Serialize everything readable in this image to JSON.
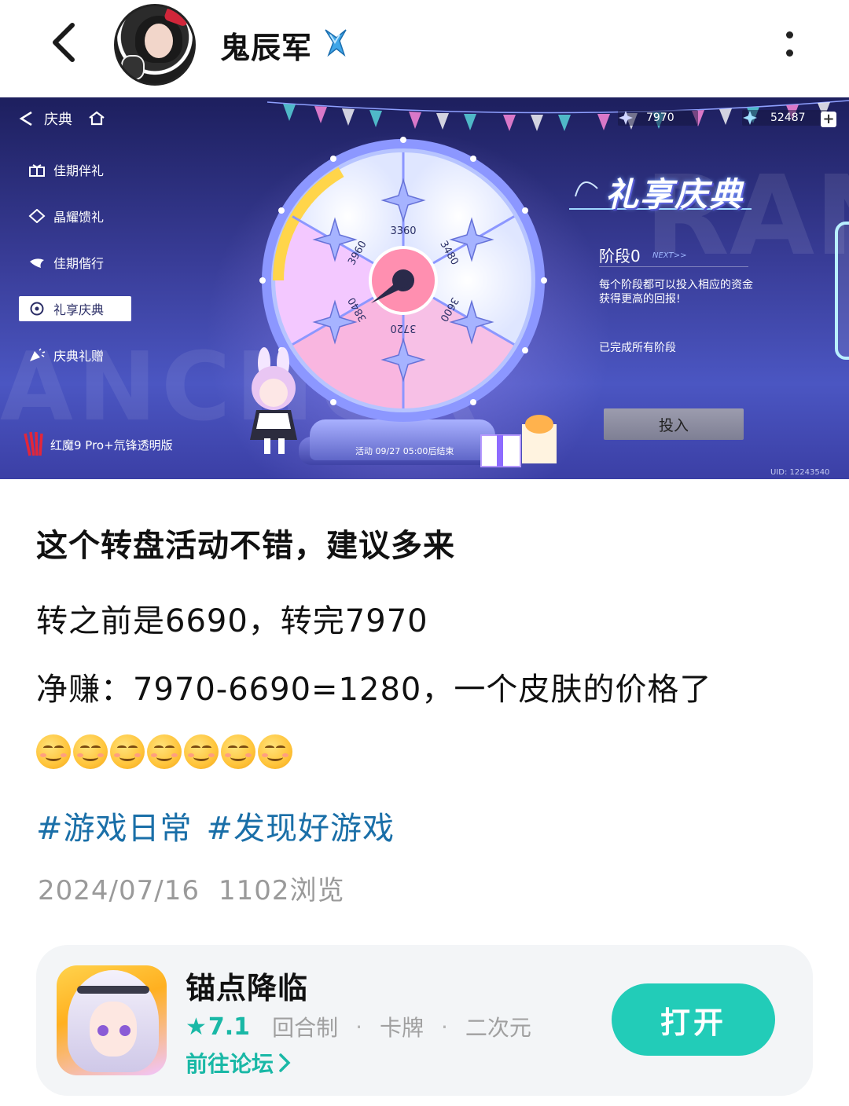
{
  "header": {
    "username": "鬼辰军"
  },
  "banner": {
    "nav_title": "庆典",
    "menu": [
      {
        "label": "佳期伴礼"
      },
      {
        "label": "晶耀馈礼"
      },
      {
        "label": "佳期偕行"
      },
      {
        "label": "礼享庆典"
      },
      {
        "label": "庆典礼赠"
      }
    ],
    "brand_label": "红魔9 Pro+氘锋透明版",
    "currency_1": "7970",
    "currency_2": "52487",
    "plus_label": "+",
    "event_title": "礼享庆典",
    "stage_label": "阶段0",
    "next_label": "NEXT>>",
    "stage_desc": "每个阶段都可以投入相应的资金获得更高的回报!",
    "stage_done": "已完成所有阶段",
    "invest_label": "投入",
    "event_time": "活动 09/27 05:00后结束",
    "uid": "UID: 12243540",
    "wheel_values": [
      "3360",
      "3480",
      "3600",
      "3720",
      "3840",
      "3960"
    ]
  },
  "post": {
    "title": "这个转盘活动不错，建议多来",
    "line1": "转之前是6690，转完7970",
    "line2": "净赚：7970-6690=1280，一个皮肤的价格了",
    "emoji_count": 7,
    "tags": [
      "#游戏日常",
      "#发现好游戏"
    ],
    "date": "2024/07/16",
    "views": "1102浏览"
  },
  "game_card": {
    "name": "锚点降临",
    "rating": "7.1",
    "genres": [
      "回合制",
      "卡牌",
      "二次元"
    ],
    "forum_label": "前往论坛",
    "open_label": "打开",
    "accent_color": "#22ccb8"
  }
}
